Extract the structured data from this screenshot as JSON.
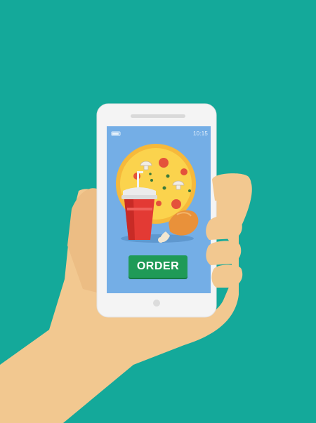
{
  "status_bar": {
    "time": "10:15"
  },
  "order_button": {
    "label": "ORDER"
  },
  "colors": {
    "background": "#14a99a",
    "phone_body": "#f4f4f4",
    "screen": "#74aee6",
    "button": "#1f9a57",
    "skin": "#f2c890"
  },
  "icons": [
    "pizza-icon",
    "soda-cup-icon",
    "chicken-leg-icon",
    "battery-icon"
  ]
}
